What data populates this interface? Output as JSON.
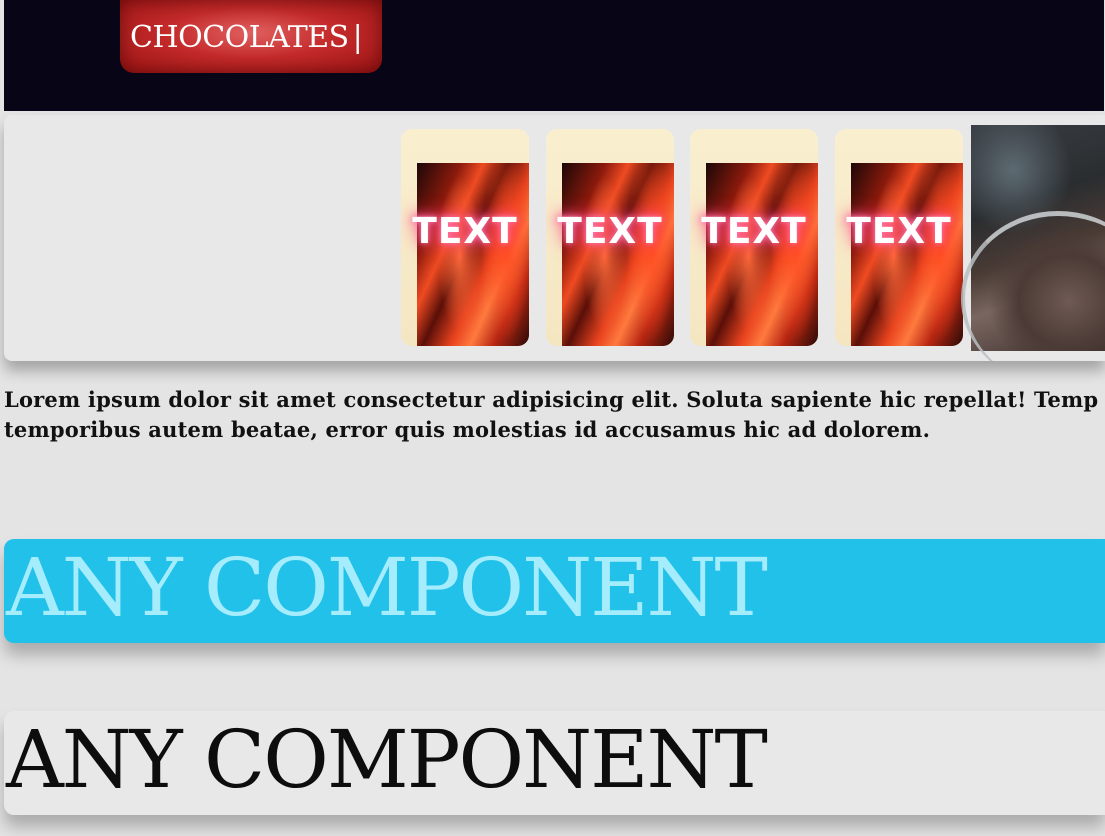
{
  "header": {
    "brand_label": "CHOCOLATES",
    "cursor": "|"
  },
  "gallery": {
    "cards": [
      {
        "label": "TEXT"
      },
      {
        "label": "TEXT"
      },
      {
        "label": "TEXT"
      },
      {
        "label": "TEXT"
      }
    ]
  },
  "content": {
    "paragraph": "Lorem ipsum dolor sit amet consectetur adipisicing elit. Soluta sapiente hic repellat! Temp temporibus autem beatae, error quis molestias id accusamus hic ad dolorem."
  },
  "components": [
    {
      "label": "ANY COMPONENT"
    },
    {
      "label": "ANY COMPONENT"
    }
  ],
  "colors": {
    "header_bg": "#070516",
    "brand_pill": "#c42a2a",
    "page_bg": "#e4e4e4",
    "blue_banner": "#22c1e9",
    "blue_banner_text": "#a5ecfd",
    "card_glow": "#ff4f88"
  }
}
